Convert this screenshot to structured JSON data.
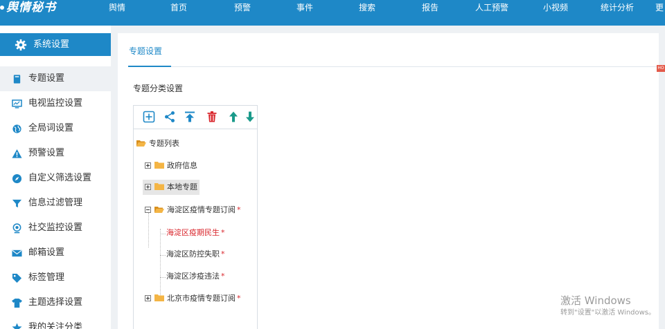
{
  "header": {
    "logo": "舆情秘书",
    "nav": [
      "舆情",
      "首页",
      "预警",
      "事件",
      "搜索",
      "报告",
      "人工预警",
      "小视频",
      "统计分析",
      "更"
    ]
  },
  "sidebar": {
    "title": "系统设置",
    "items": [
      {
        "label": "专题设置",
        "icon": "book-icon"
      },
      {
        "label": "电视监控设置",
        "icon": "monitor-icon"
      },
      {
        "label": "全局词设置",
        "icon": "globe-icon"
      },
      {
        "label": "预警设置",
        "icon": "warning-icon"
      },
      {
        "label": "自定义筛选设置",
        "icon": "compass-icon"
      },
      {
        "label": "信息过滤管理",
        "icon": "filter-icon"
      },
      {
        "label": "社交监控设置",
        "icon": "webcam-icon"
      },
      {
        "label": "邮箱设置",
        "icon": "mail-icon"
      },
      {
        "label": "标签管理",
        "icon": "tag-icon"
      },
      {
        "label": "主题选择设置",
        "icon": "shirt-icon"
      },
      {
        "label": "我的关注分类",
        "icon": "star-icon"
      }
    ]
  },
  "main": {
    "tab": "专题设置",
    "section_title": "专题分类设置",
    "toolbar": [
      "add-icon",
      "share-icon",
      "move-top-icon",
      "delete-icon",
      "move-up-icon",
      "move-down-icon"
    ],
    "tree": {
      "root": "专题列表",
      "nodes": [
        {
          "label": "政府信息",
          "state": "collapsed",
          "starred": false
        },
        {
          "label": "本地专题",
          "state": "collapsed",
          "starred": false
        },
        {
          "label": "海淀区疫情专题订阅",
          "state": "expanded",
          "starred": true,
          "children": [
            {
              "label": "海淀区疫期民生",
              "starred": true,
              "selected": true
            },
            {
              "label": "海淀区防控失职",
              "starred": true
            },
            {
              "label": "海淀区涉疫违法",
              "starred": true
            }
          ]
        },
        {
          "label": "北京市疫情专题订阅",
          "state": "collapsed",
          "starred": true
        }
      ],
      "star": "*"
    }
  },
  "badge": "HO",
  "watermark": {
    "line1": "激活 Windows",
    "line2": "转到\"设置\"以激活 Windows。"
  },
  "colors": {
    "accent": "#1e88c7",
    "danger": "#d9262c",
    "folder": "#f0a830"
  }
}
